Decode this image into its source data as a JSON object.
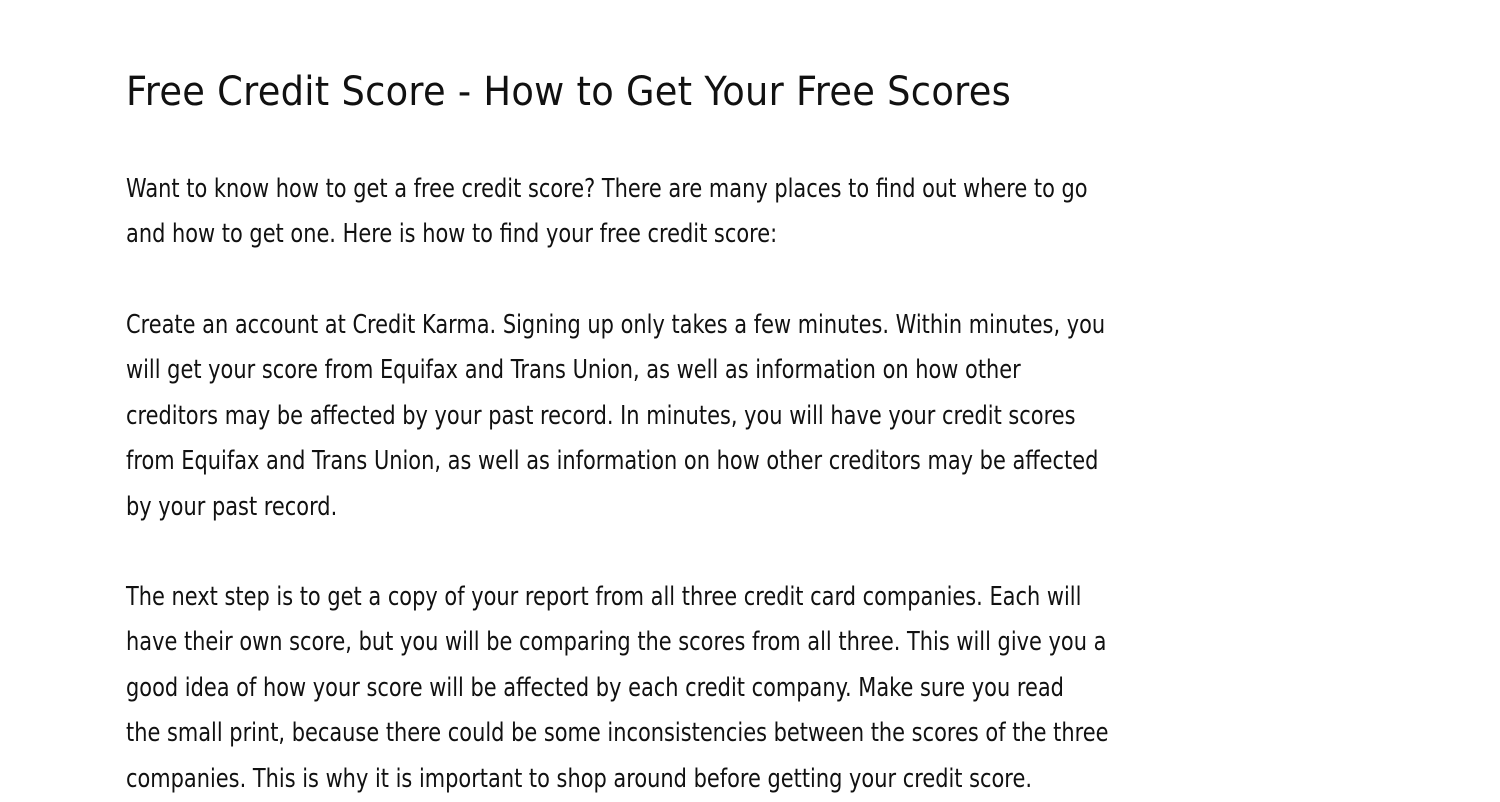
{
  "document": {
    "title": "Free Credit Score - How to Get Your Free Scores",
    "paragraphs": [
      {
        "lines": [
          "Want to know how to get a free credit score? There are many places to find out where to go",
          "and how to get one. Here is how to find your free credit score:"
        ]
      },
      {
        "lines": [
          "Create an account at Credit Karma. Signing up only takes a few minutes. Within minutes, you",
          "will get your score from Equifax and Trans Union, as well as information on how other",
          "creditors may be affected by your past record. In minutes, you will have your credit scores",
          "from Equifax and Trans Union, as well as information on how other creditors may be affected",
          "by your past record."
        ]
      },
      {
        "lines": [
          "The next step is to get a copy of your report from all three credit card companies. Each will",
          "have their own score, but you will be comparing the scores from all three. This will give you a",
          "good idea of how your score will be affected by each credit company. Make sure you read",
          "the small print, because there could be some inconsistencies between the scores of the three",
          "companies. This is why it is important to shop around before getting your credit score."
        ]
      }
    ]
  }
}
